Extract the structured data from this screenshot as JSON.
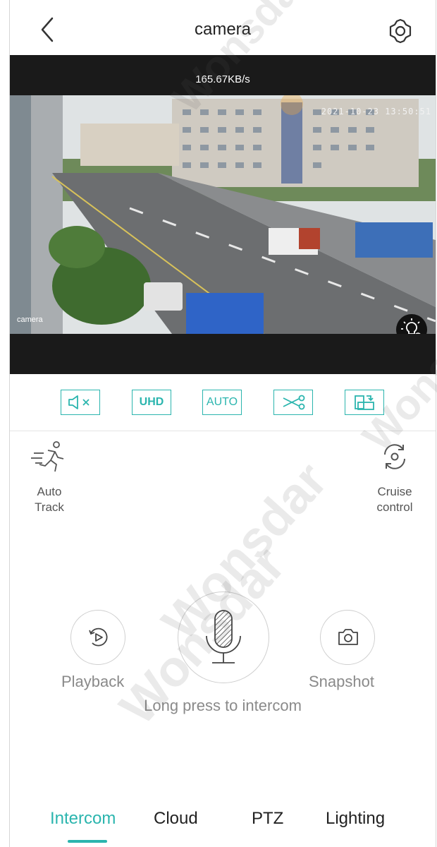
{
  "header": {
    "title": "camera",
    "back_icon": "chevron-left-icon",
    "settings_icon": "gear-icon"
  },
  "video": {
    "speed": "165.67KB/s",
    "timestamp": "2021-10-23 13:50:51",
    "camera_label": "camera",
    "light_icon": "light-settings-icon"
  },
  "toolbar": {
    "mute_icon": "speaker-mute-icon",
    "quality": "UHD",
    "mode": "AUTO",
    "clip_icon": "scissors-icon",
    "orientation_icon": "rotate-screen-icon"
  },
  "features": {
    "auto_track": "Auto\nTrack",
    "cruise": "Cruise\ncontrol",
    "playback": "Playback",
    "snapshot": "Snapshot",
    "intercom_hint": "Long press to intercom"
  },
  "tabs": [
    "Intercom",
    "Cloud",
    "PTZ",
    "Lighting"
  ],
  "active_tab": "Intercom",
  "watermark": "Wonsdar",
  "colors": {
    "accent": "#2bb5ae",
    "video_bg": "#1a1a1a"
  }
}
